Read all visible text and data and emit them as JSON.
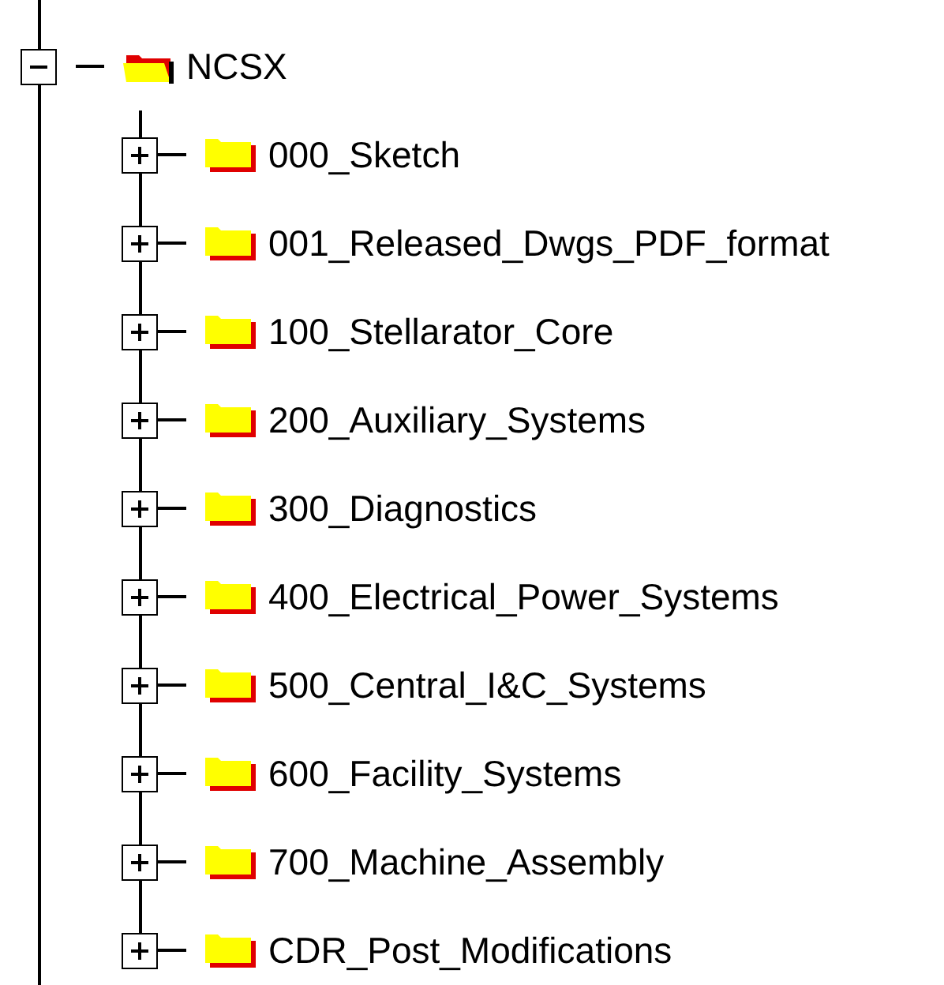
{
  "tree": {
    "label": "NCSX",
    "expanded": true,
    "children": [
      {
        "label": "000_Sketch",
        "expanded": false
      },
      {
        "label": "001_Released_Dwgs_PDF_format",
        "expanded": false
      },
      {
        "label": "100_Stellarator_Core",
        "expanded": false
      },
      {
        "label": "200_Auxiliary_Systems",
        "expanded": false
      },
      {
        "label": "300_Diagnostics",
        "expanded": false
      },
      {
        "label": "400_Electrical_Power_Systems",
        "expanded": false
      },
      {
        "label": "500_Central_I&C_Systems",
        "expanded": false
      },
      {
        "label": "600_Facility_Systems",
        "expanded": false
      },
      {
        "label": "700_Machine_Assembly",
        "expanded": false
      },
      {
        "label": "CDR_Post_Modifications",
        "expanded": false
      }
    ]
  }
}
